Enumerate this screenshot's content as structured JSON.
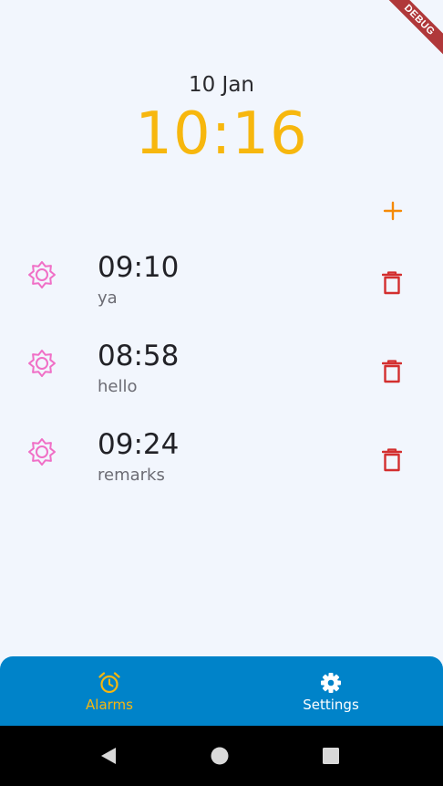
{
  "debug_banner": "DEBUG",
  "header": {
    "date": "10 Jan",
    "time": "10:16"
  },
  "colors": {
    "background": "#F2F6FD",
    "clock": "#F7B70E",
    "add_icon": "#F58A07",
    "alarm_icon": "#F06FC6",
    "delete_icon": "#D32F2F",
    "nav_background": "#0083C9",
    "nav_active": "#F7B70E",
    "nav_inactive": "#FFFFFF"
  },
  "toolbar": {
    "add_icon": "plus-icon"
  },
  "alarms": [
    {
      "time": "09:10",
      "remark": "ya",
      "icon": "sun-icon",
      "delete_icon": "trash-icon"
    },
    {
      "time": "08:58",
      "remark": "hello",
      "icon": "sun-icon",
      "delete_icon": "trash-icon"
    },
    {
      "time": "09:24",
      "remark": "remarks",
      "icon": "sun-icon",
      "delete_icon": "trash-icon"
    }
  ],
  "bottom_nav": {
    "items": [
      {
        "label": "Alarms",
        "icon": "alarm-clock-icon",
        "active": true
      },
      {
        "label": "Settings",
        "icon": "gear-icon",
        "active": false
      }
    ]
  },
  "system_nav": {
    "buttons": [
      "back-icon",
      "home-icon",
      "recents-icon"
    ]
  }
}
